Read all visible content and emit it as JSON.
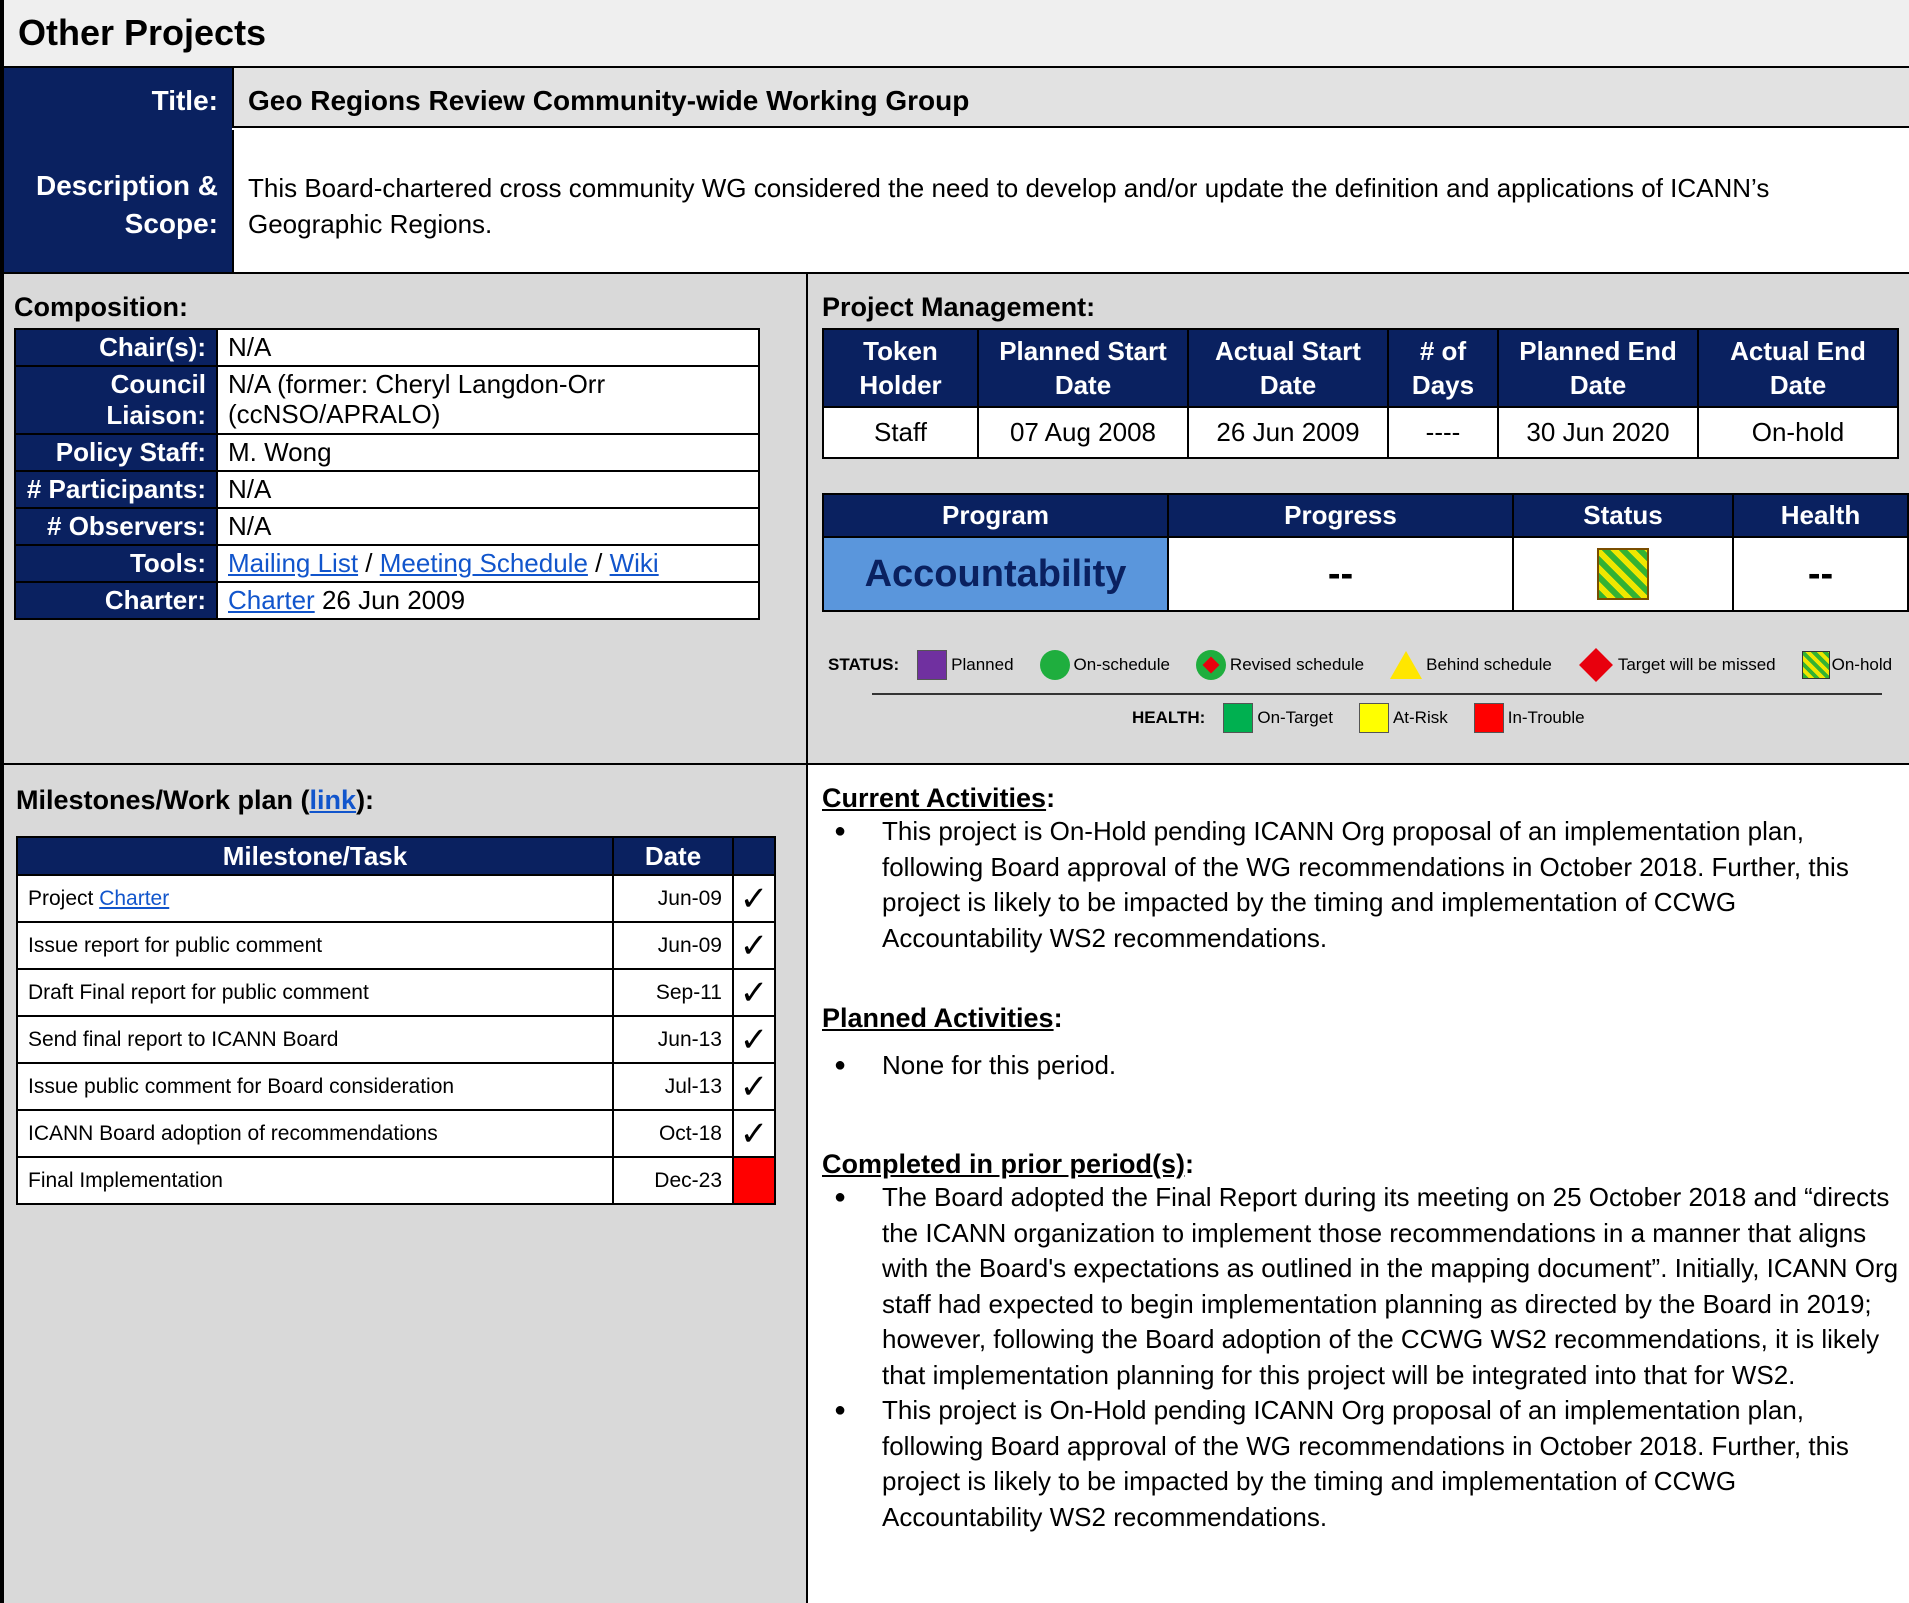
{
  "header": {
    "title": "Other Projects"
  },
  "title_row": {
    "label": "Title:",
    "value": "Geo Regions Review Community-wide Working Group"
  },
  "description_row": {
    "label_line1": "Description &",
    "label_line2": "Scope:",
    "value": "This Board-chartered cross community WG considered the need to develop and/or update  the definition and applications of ICANN’s Geographic Regions."
  },
  "composition": {
    "heading": "Composition:",
    "chairs_label": "Chair(s):",
    "chairs_value": "N/A",
    "liaison_label": "Council Liaison:",
    "liaison_value": "N/A (former: Cheryl Langdon-Orr (ccNSO/APRALO)",
    "staff_label": "Policy Staff:",
    "staff_value": "M. Wong",
    "participants_label": "# Participants:",
    "participants_value": "N/A",
    "observers_label": "# Observers:",
    "observers_value": "N/A",
    "tools_label": "Tools:",
    "tools_mailing": "Mailing List",
    "tools_sep": "/",
    "tools_meeting": "Meeting Schedule",
    "tools_wiki": "Wiki",
    "charter_label": "Charter:",
    "charter_link": "Charter",
    "charter_date": "26 Jun 2009"
  },
  "project_management": {
    "heading": "Project Management:",
    "headers": [
      "Token Holder",
      "Planned Start Date",
      "Actual Start Date",
      "# of Days",
      "Planned End Date",
      "Actual End Date"
    ],
    "values": [
      "Staff",
      "07 Aug 2008",
      "26 Jun 2009",
      "----",
      "30 Jun 2020",
      "On-hold"
    ]
  },
  "program": {
    "headers": [
      "Program",
      "Progress",
      "Status",
      "Health"
    ],
    "program_value": "Accountability",
    "progress_value": "--",
    "health_value": "--"
  },
  "legend": {
    "status_label": "STATUS:",
    "planned": "Planned",
    "on_schedule": "On-schedule",
    "revised": "Revised schedule",
    "behind": "Behind schedule",
    "missed": "Target will be missed",
    "on_hold": "On-hold",
    "health_label": "HEALTH:",
    "on_target": "On-Target",
    "at_risk": "At-Risk",
    "in_trouble": "In-Trouble",
    "colors": {
      "planned": "#7030a0",
      "on_schedule": "#1fae3e",
      "missed": "#e8000d",
      "on_target": "#00b050",
      "at_risk": "#ffff00",
      "in_trouble": "#ff0000"
    }
  },
  "milestones": {
    "heading_pre": "Milestones/Work plan (",
    "heading_link": "link",
    "heading_post": "):",
    "col_task": "Milestone/Task",
    "col_date": "Date",
    "check_glyph": "✓",
    "rows": [
      {
        "task_pre": "Project ",
        "task_link": "Charter",
        "date": "Jun-09"
      },
      {
        "task": "Issue report for public comment",
        "date": "Jun-09"
      },
      {
        "task": "Draft Final report for public comment",
        "date": "Sep-11"
      },
      {
        "task": "Send final report to ICANN Board",
        "date": "Jun-13"
      },
      {
        "task": "Issue public comment for Board consideration",
        "date": "Jul-13"
      },
      {
        "task": "ICANN Board adoption of recommendations",
        "date": "Oct-18"
      },
      {
        "task": "Final Implementation",
        "date": "Dec-23"
      }
    ]
  },
  "activities": {
    "current_heading": "Current Activities",
    "current_items": [
      "This project is On-Hold pending ICANN Org proposal of an implementation plan, following Board approval of the WG recommendations in October 2018. Further, this project is likely to  be impacted by the timing and implementation of CCWG Accountability WS2 recommendations."
    ],
    "planned_heading": "Planned Activities",
    "planned_items": [
      "None for this period."
    ],
    "completed_heading": "Completed in prior period(s)",
    "completed_items": [
      "The Board adopted the Final Report during its meeting on 25 October 2018 and “directs the ICANN organization to implement those recommendations in a manner that aligns with the Board's expectations as outlined in the mapping document”. Initially, ICANN Org staff had expected to begin implementation planning as directed by the Board in 2019; however, following the Board adoption of the CCWG WS2 recommendations, it is likely that implementation planning for this project will be integrated into that for WS2.",
      "This project is On-Hold pending ICANN Org proposal of an implementation plan, following Board approval of the WG recommendations in October 2018. Further, this project is likely to  be impacted by the timing and implementation of CCWG Accountability WS2 recommendations."
    ],
    "colon": ":"
  }
}
